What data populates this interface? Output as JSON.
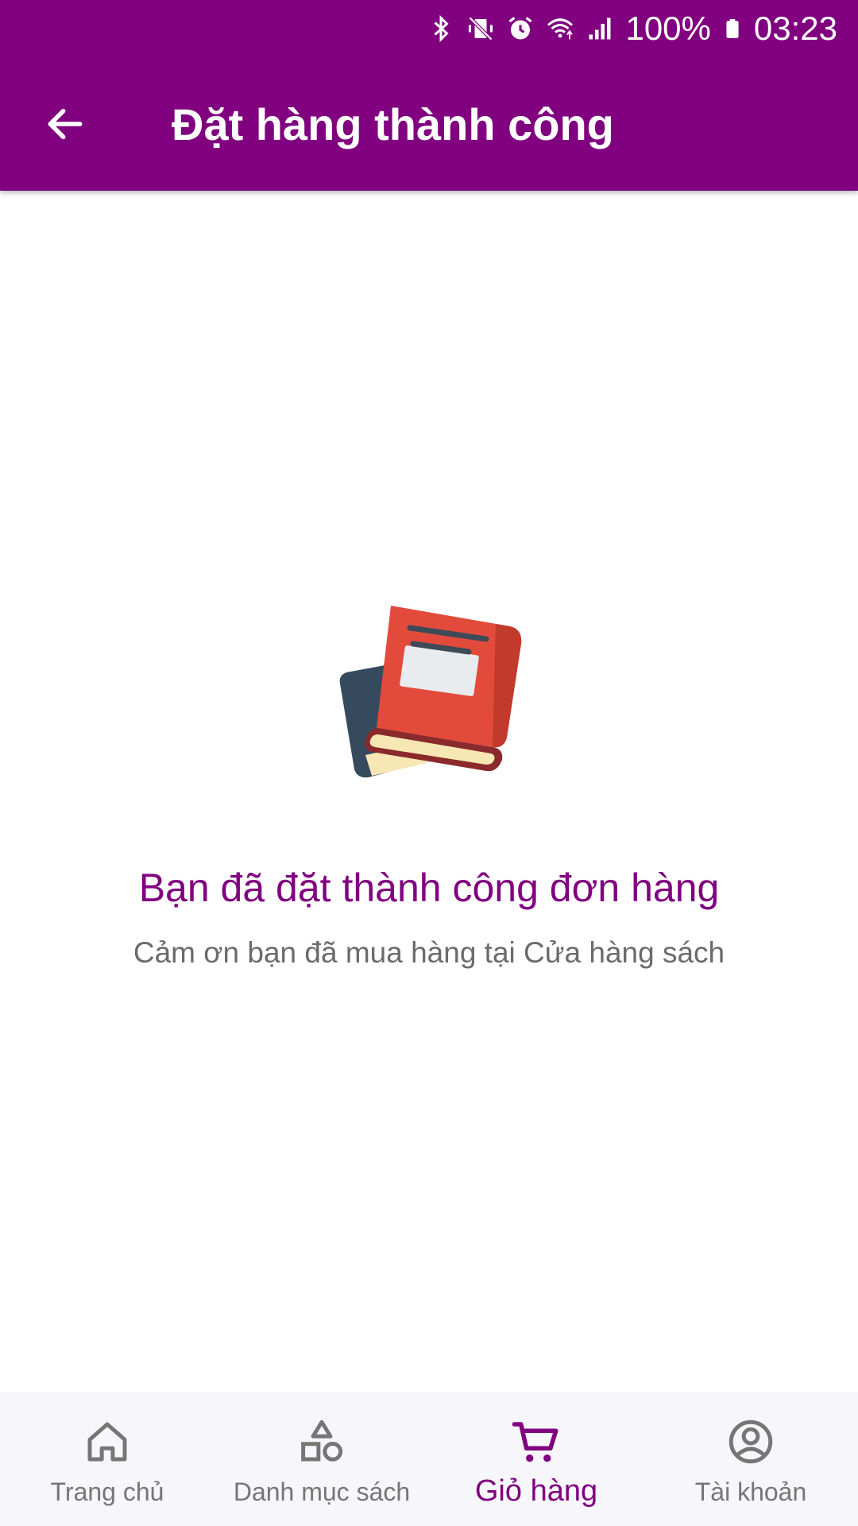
{
  "status_bar": {
    "battery": "100%",
    "time": "03:23",
    "icons": [
      "bluetooth-icon",
      "vibrate-mute-icon",
      "alarm-icon",
      "wifi-icon",
      "signal-icon",
      "battery-icon"
    ]
  },
  "app_bar": {
    "title": "Đặt hàng thành công",
    "back_icon": "arrow-left-icon",
    "background": "#800080"
  },
  "main": {
    "illustration_icon": "books-icon",
    "headline": "Bạn đã đặt thành công đơn hàng",
    "subline": "Cảm ơn bạn đã mua hàng tại Cửa hàng sách",
    "headline_color": "#800080"
  },
  "bottom_nav": {
    "active_index": 2,
    "active_color": "#800080",
    "items": [
      {
        "label": "Trang chủ",
        "icon": "home-icon"
      },
      {
        "label": "Danh mục sách",
        "icon": "category-icon"
      },
      {
        "label": "Giỏ hàng",
        "icon": "cart-icon"
      },
      {
        "label": "Tài khoản",
        "icon": "account-icon"
      }
    ]
  }
}
